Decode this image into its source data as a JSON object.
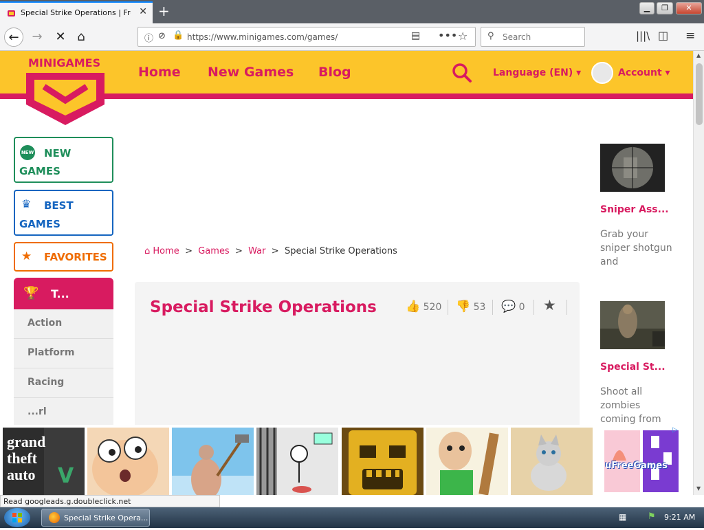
{
  "browser": {
    "tab_title": "Special Strike Operations | Free",
    "url": "https://www.minigames.com/games/special_strike",
    "search_placeholder": "Search",
    "status_text": "Read googleads.g.doubleclick.net"
  },
  "site": {
    "logo_text": "MINIGAMES",
    "nav": [
      "Home",
      "New Games",
      "Blog"
    ],
    "language": "Language (EN)",
    "account": "Account",
    "sidebar": {
      "new_games": "NEW GAMES",
      "new_badge": "NEW",
      "best_games": "BEST GAMES",
      "favorites": "FAVORITES",
      "categories_title": "T...",
      "categories": [
        "Action",
        "Platform",
        "Racing",
        "...rl"
      ]
    },
    "breadcrumb": {
      "home": "Home",
      "games": "Games",
      "war": "War",
      "current": "Special Strike Operations",
      "sep": ">"
    },
    "game": {
      "title": "Special Strike Operations",
      "likes": "520",
      "dislikes": "53",
      "comments": "0"
    },
    "related": [
      {
        "title": "Sniper Ass...",
        "desc": "Grab your sniper shotgun and"
      },
      {
        "title": "Special St...",
        "desc": "Shoot all zombies coming from"
      }
    ],
    "ads": {
      "freegames_label": "uFreeGames",
      "tiles": [
        "grand-theft-auto",
        "cartoon-face",
        "man-with-hammer",
        "prison-stickman",
        "temple-mask",
        "baldi-teacher",
        "kitten",
        "ufreegames"
      ]
    }
  },
  "taskbar": {
    "task_label": "Special Strike Opera...",
    "time": "9:21 AM"
  },
  "colors": {
    "brand_pink": "#d81b60",
    "brand_yellow": "#fcc52a",
    "green": "#1e8e5a",
    "blue": "#1565c0",
    "orange": "#ef6c00"
  }
}
